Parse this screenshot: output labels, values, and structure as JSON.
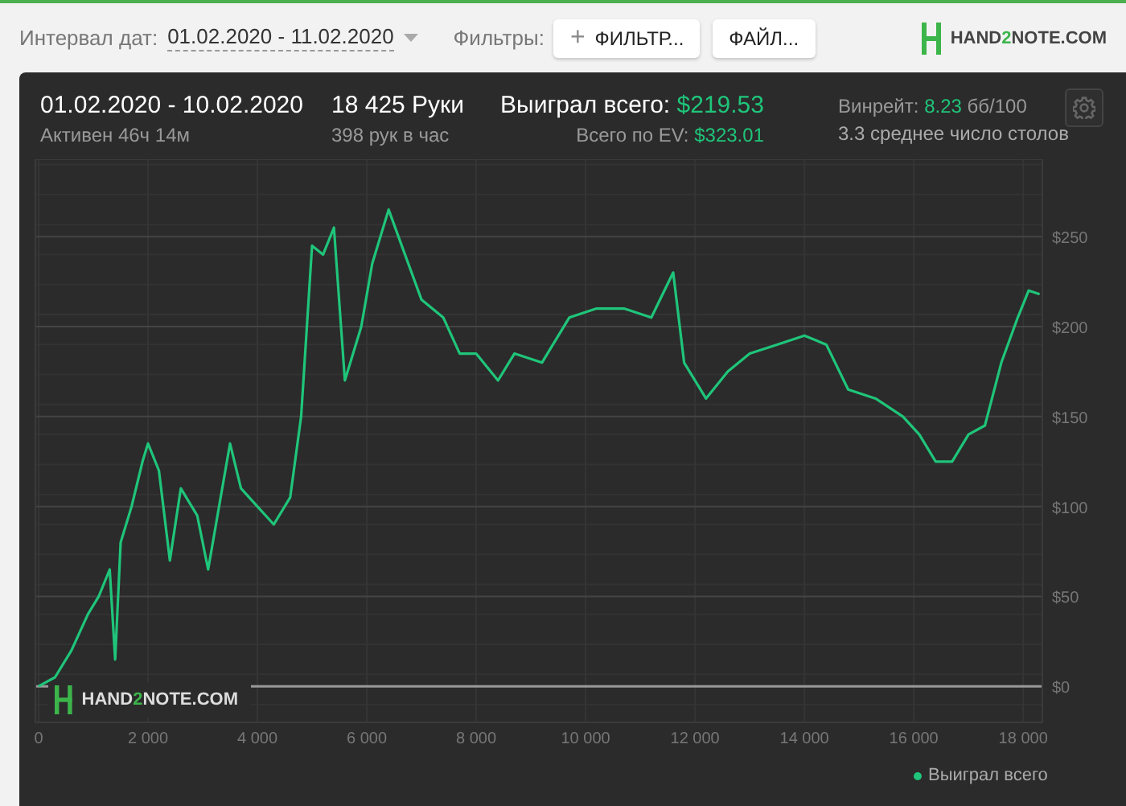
{
  "toolbar": {
    "date_label": "Интервал дат:",
    "date_range": "01.02.2020 - 11.02.2020",
    "filters_label": "Фильтры:",
    "filter_button": {
      "icon": "+",
      "label": "ФИЛЬТР..."
    },
    "file_button": "ФАЙЛ...",
    "logo": {
      "before": "HAND",
      "accent": "2",
      "after": "NOTE.COM"
    }
  },
  "summary": {
    "period": "01.02.2020 - 10.02.2020",
    "active": "Активен 46ч 14м",
    "hands": "18 425 Руки",
    "hands_per_hour": "398 рук в час",
    "won_label": "Выиграл всего:",
    "won_value": "$219.53",
    "ev_label": "Всего по EV:",
    "ev_value": "$323.01",
    "winrate_label": "Винрейт:",
    "winrate_value": "8.23",
    "winrate_unit": "бб/100",
    "tables": "3.3 среднее число столов"
  },
  "chart_watermark": {
    "before": "HAND",
    "accent": "2",
    "after": "NOTE.COM"
  },
  "chart_data": {
    "type": "line",
    "x": [
      0,
      300,
      600,
      900,
      1100,
      1300,
      1400,
      1500,
      1700,
      1900,
      2000,
      2200,
      2400,
      2600,
      2900,
      3100,
      3300,
      3500,
      3700,
      4000,
      4300,
      4600,
      4800,
      5000,
      5200,
      5400,
      5600,
      5900,
      6100,
      6400,
      6700,
      7000,
      7400,
      7700,
      8000,
      8400,
      8700,
      9200,
      9700,
      10200,
      10700,
      11200,
      11600,
      11800,
      12200,
      12600,
      13000,
      13500,
      14000,
      14400,
      14800,
      15300,
      15800,
      16100,
      16400,
      16700,
      17000,
      17300,
      17600,
      17900,
      18100,
      18300
    ],
    "series": [
      {
        "name": "Выиграл всего",
        "color": "#1fc57a",
        "values": [
          0,
          5,
          20,
          40,
          50,
          65,
          15,
          80,
          100,
          125,
          135,
          120,
          70,
          110,
          95,
          65,
          100,
          135,
          110,
          100,
          90,
          105,
          150,
          245,
          240,
          255,
          170,
          200,
          235,
          265,
          240,
          215,
          205,
          185,
          185,
          170,
          185,
          180,
          205,
          210,
          210,
          205,
          230,
          180,
          160,
          175,
          185,
          190,
          195,
          190,
          165,
          160,
          150,
          140,
          125,
          125,
          140,
          145,
          180,
          205,
          220,
          218
        ]
      }
    ],
    "grid": true,
    "xlim": [
      0,
      18350
    ],
    "ylim": [
      -20,
      293
    ],
    "xticks": [
      0,
      {
        "value": 2000,
        "label": "2 000"
      },
      {
        "value": 4000,
        "label": "4 000"
      },
      {
        "value": 6000,
        "label": "6 000"
      },
      {
        "value": 8000,
        "label": "8 000"
      },
      {
        "value": 10000,
        "label": "10 000"
      },
      {
        "value": 12000,
        "label": "12 000"
      },
      {
        "value": 14000,
        "label": "14 000"
      },
      {
        "value": 16000,
        "label": "16 000"
      },
      {
        "value": 18000,
        "label": "18 000"
      }
    ],
    "yticks": [
      {
        "value": 0,
        "label": "$0"
      },
      {
        "value": 50,
        "label": "$50"
      },
      {
        "value": 100,
        "label": "$100"
      },
      {
        "value": 150,
        "label": "$150"
      },
      {
        "value": 200,
        "label": "$200"
      },
      {
        "value": 250,
        "label": "$250"
      }
    ]
  }
}
